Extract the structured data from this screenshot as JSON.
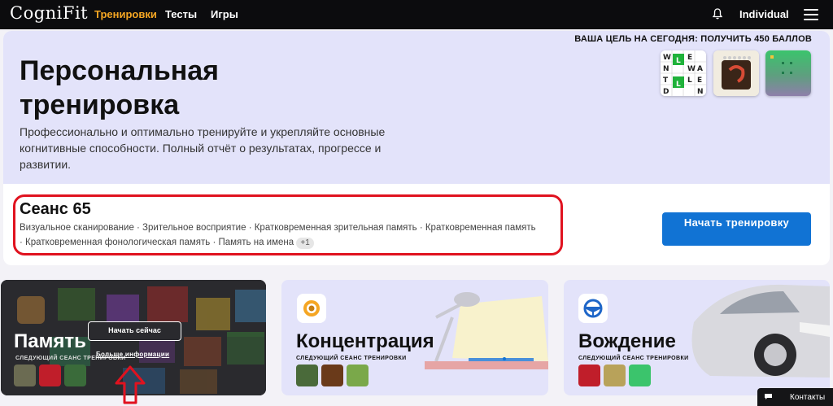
{
  "nav": {
    "logo": "CogniFit",
    "links": [
      "Тренировки",
      "Тесты",
      "Игры"
    ],
    "active_link": "Тренировки",
    "account": "Individual"
  },
  "hero": {
    "goal": "ВАША ЦЕЛЬ НА СЕГОДНЯ: ПОЛУЧИТЬ 450 БАЛЛОВ",
    "title": "Персональная тренировка",
    "description": "Профессионально и оптимально тренируйте и укрепляйте основные когнитивные способности. Полный отчёт о результатах, прогрессе и развитии.",
    "thumbnails": [
      "word-grid-game-icon",
      "notebook-game-icon",
      "green-grid-game-icon"
    ]
  },
  "session": {
    "title": "Сеанс 65",
    "skills_line1": "Визуальное сканирование · Зрительное восприятие · Кратковременная зрительная память · Кратковременная память",
    "skills_line2": "· Кратковременная фонологическая память · Память на имена",
    "extra_count": "+1",
    "start_button": "Начать тренировку"
  },
  "categories": [
    {
      "title": "Память",
      "subtitle": "СЛЕДУЮЩИЙ СЕАНС ТРЕНИРОВКИ",
      "start_button": "Начать сейчас",
      "more_link": "Больше информации"
    },
    {
      "title": "Концентрация",
      "subtitle": "СЛЕДУЮЩИЙ СЕАНС ТРЕНИРОВКИ"
    },
    {
      "title": "Вождение",
      "subtitle": "СЛЕДУЮЩИЙ СЕАНС ТРЕНИРОВКИ"
    }
  ],
  "contacts": "Контакты",
  "colors": {
    "accent": "#f5a623",
    "primary_button": "#1173d4",
    "highlight_border": "#e0121f",
    "hero_background": "#e3e3fa",
    "nav_background": "#0c0c0e"
  }
}
